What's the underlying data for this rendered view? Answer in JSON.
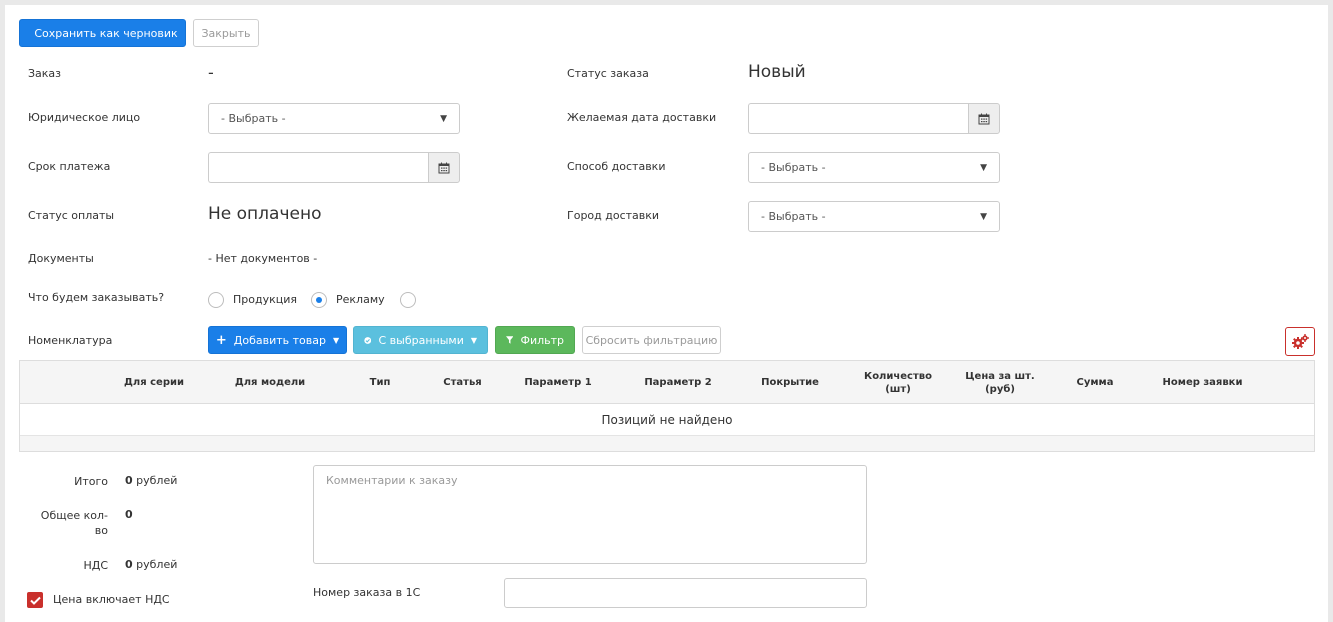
{
  "toolbar": {
    "save_draft_label": "Сохранить как черновик",
    "close_label": "Закрыть"
  },
  "form": {
    "order_label": "Заказ",
    "order_value": "-",
    "legal_entity_label": "Юридическое лицо",
    "legal_entity_value": "- Выбрать -",
    "payment_due_label": "Срок платежа",
    "payment_status_label": "Статус оплаты",
    "payment_status_value": "Не оплачено",
    "documents_label": "Документы",
    "documents_value": "- Нет документов -",
    "what_order_label": "Что будем заказывать?",
    "order_type_options": [
      "Продукция",
      "Рекламу",
      ""
    ],
    "order_type_selected": 1,
    "order_status_label": "Статус заказа",
    "order_status_value": "Новый",
    "desired_date_label": "Желаемая дата доставки",
    "delivery_method_label": "Способ доставки",
    "delivery_method_value": "- Выбрать -",
    "delivery_city_label": "Город доставки",
    "delivery_city_value": "- Выбрать -"
  },
  "nomenclature": {
    "label": "Номенклатура",
    "add_item_label": "Добавить товар",
    "with_selected_label": "С выбранными",
    "filter_label": "Фильтр",
    "reset_filter_label": "Сбросить фильтрацию"
  },
  "table": {
    "columns": [
      {
        "line1": "Для серии",
        "line2": ""
      },
      {
        "line1": "Для модели",
        "line2": ""
      },
      {
        "line1": "Тип",
        "line2": ""
      },
      {
        "line1": "Статья",
        "line2": ""
      },
      {
        "line1": "Параметр 1",
        "line2": ""
      },
      {
        "line1": "Параметр 2",
        "line2": ""
      },
      {
        "line1": "Покрытие",
        "line2": ""
      },
      {
        "line1": "Количество",
        "line2": "(шт)"
      },
      {
        "line1": "Цена за шт.",
        "line2": "(руб)"
      },
      {
        "line1": "Сумма",
        "line2": ""
      },
      {
        "line1": "Номер заявки",
        "line2": ""
      }
    ],
    "empty_text": "Позиций не найдено"
  },
  "summary": {
    "total_label": "Итого",
    "total_value": "0",
    "total_unit": "рублей",
    "qty_label_line1": "Общее кол-",
    "qty_label_line2": "во",
    "qty_value": "0",
    "vat_label": "НДС",
    "vat_value": "0",
    "vat_unit": "рублей",
    "price_includes_vat_label": "Цена включает НДС",
    "price_includes_vat_checked": true
  },
  "comments": {
    "placeholder": "Комментарии к заказу",
    "order_1c_label": "Номер заказа в 1С"
  },
  "colors": {
    "primary": "#1a7fe8",
    "info": "#5bc0de",
    "success": "#5cb85c",
    "danger": "#c9302c"
  }
}
